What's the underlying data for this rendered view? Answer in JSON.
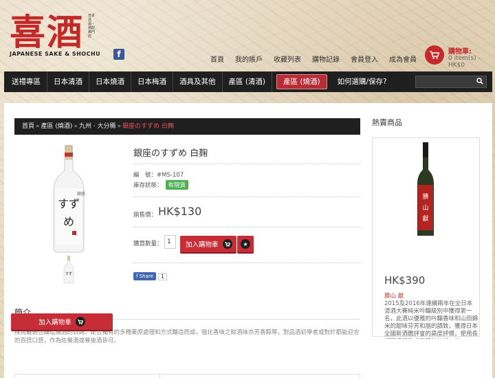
{
  "brand": {
    "logo_kanji": "喜酒",
    "logo_sub": "JAPANESE SAKE & SHOCHU",
    "logo_vertical": "日本清酒・燒酎專門店",
    "colors": {
      "red": "#c52a2a",
      "dark": "#1f1f1f"
    }
  },
  "top_links": [
    "首頁",
    "我的賬戶",
    "收藏列表",
    "購物記錄",
    "會員登入",
    "成為會員"
  ],
  "cart": {
    "title": "購物車:",
    "summary": "0 item(s) - HK$0"
  },
  "nav": {
    "items": [
      "送禮專區",
      "日本清酒",
      "日本燒酒",
      "日本梅酒",
      "酒具及其他",
      "產區 (清酒)",
      "產區 (燒酒)",
      "如何選購/保存?"
    ],
    "active_index": 6,
    "search_icon": "search-icon"
  },
  "breadcrumb": {
    "items": [
      "首頁",
      "產區 (燒酒)",
      "九州 · 大分縣"
    ],
    "current": "銀座のすずめ 白麹"
  },
  "product": {
    "title": "銀座のすずめ 白麹",
    "sku_label": "編　號：",
    "sku": "#MS-107",
    "stock_label": "庫存狀態：",
    "stock_value": "有現貨",
    "price_label": "銷售價：",
    "price": "HK$130",
    "qty_label": "購買數量：",
    "qty_value": "1",
    "add_to_cart": "加入購物車",
    "fb_share": "Share",
    "fb_count": "1"
  },
  "intro": {
    "title": "簡介",
    "text": "採用最適合釀造燒酒的白麹，配合獨有的多種藥原處理和方式釀造而成，強化香味之餘酒味亦芳香醇厚，對品酒初學者或對於都能迎合的百搭口感，作為佐餐酒或餐後酒皆可。"
  },
  "sidebar": {
    "title": "熱賣商品",
    "price": "HK$390",
    "name": "勝山 獻",
    "desc": "2015及2016年連續兩年在全日本清酒大賽純米吟釀級別中獲得第一名，此酒以優雅的吟釀香味和山田錦米的甜味芬芳和諧的韻致，獲得日本全國新酒鑑評會的高度評價，使用長期間低溫熟成發酵的技術，並",
    "add_to_cart": "加入購物車",
    "label_text": "勝山獻"
  }
}
